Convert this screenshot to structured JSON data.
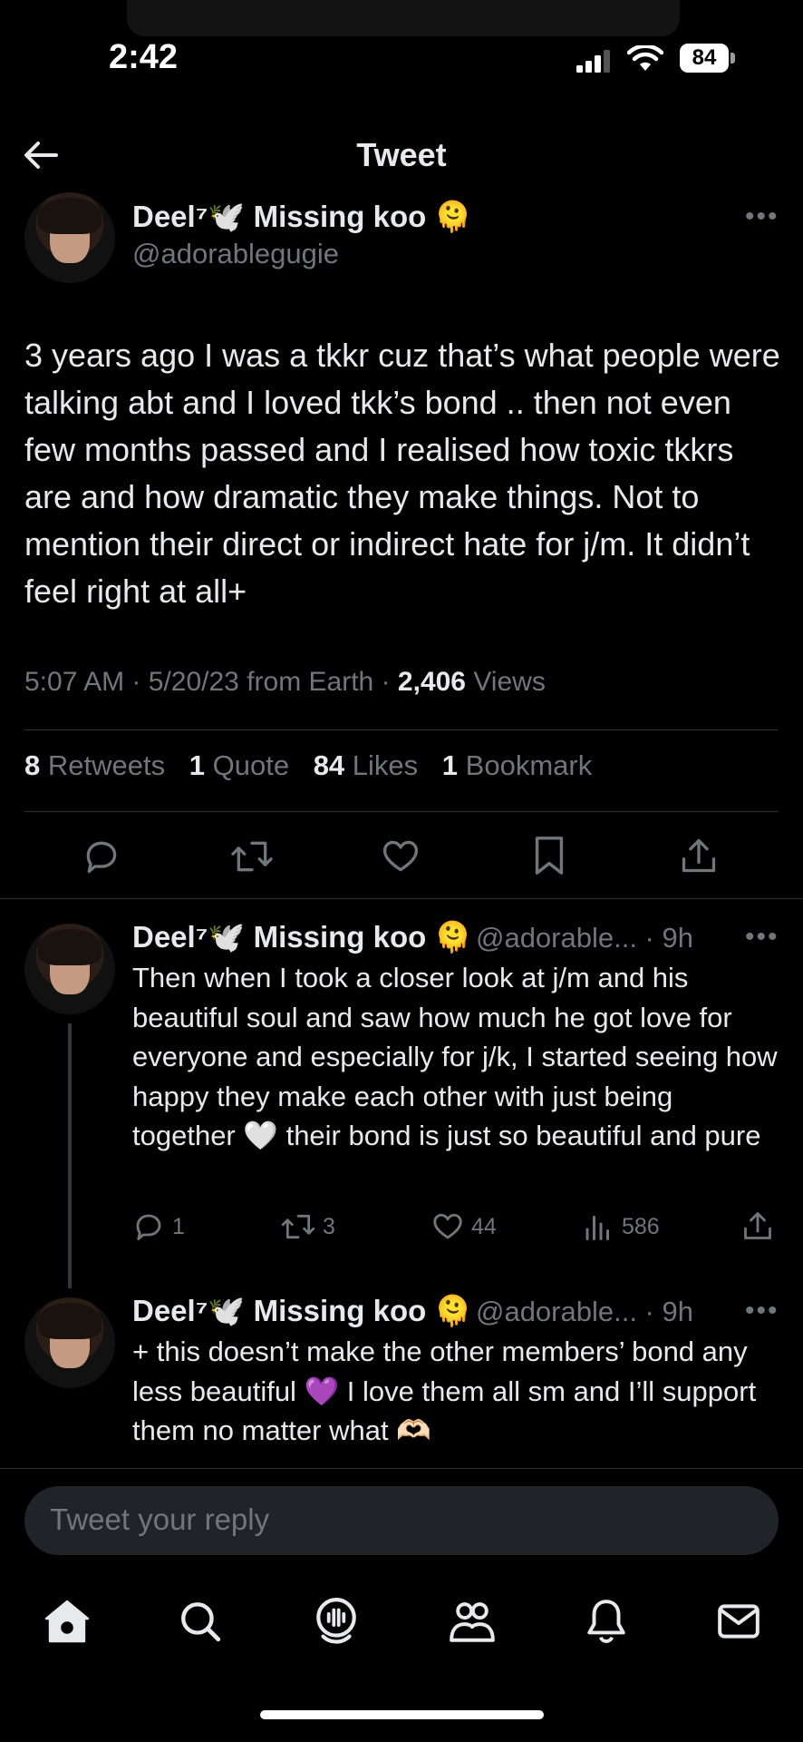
{
  "status_bar": {
    "time": "2:42",
    "battery": "84"
  },
  "header": {
    "title": "Tweet"
  },
  "tweet": {
    "author_name": "Deel⁷🕊️ Missing koo 🫠",
    "handle": "@adorablegugie",
    "text": "3 years ago I was a tkkr cuz that’s what people were talking abt and I loved tkk’s bond .. then not even few months passed and I realised how toxic tkkrs are and how dramatic they make things. Not to mention their direct or indirect hate for j/m. It didn’t feel right at all+",
    "time": "5:07 AM",
    "sep1": "·",
    "date": "5/20/23 from Earth",
    "sep2": "·",
    "views_count": "2,406",
    "views_label": "Views",
    "stats": {
      "retweets_count": "8",
      "retweets_label": "Retweets",
      "quotes_count": "1",
      "quotes_label": "Quote",
      "likes_count": "84",
      "likes_label": "Likes",
      "bookmarks_count": "1",
      "bookmarks_label": "Bookmark"
    }
  },
  "replies": [
    {
      "author_name": "Deel⁷🕊️ Missing koo 🫠",
      "handle_time": "@adorable... · 9h",
      "text": "Then when I took a closer look at j/m and his beautiful soul and saw how much he got love for everyone and especially for j/k, I started seeing how happy they make each other with just being together 🤍 their bond is just so beautiful and pure",
      "replies": "1",
      "retweets": "3",
      "likes": "44",
      "views": "586"
    },
    {
      "author_name": "Deel⁷🕊️ Missing koo 🫠",
      "handle_time": "@adorable... · 9h",
      "text": "+ this doesn’t make the other members’ bond any less beautiful 💜 I love them all sm and I’ll support them no matter what 🫶🏻"
    }
  ],
  "composer": {
    "placeholder": "Tweet your reply"
  },
  "icons": {
    "back": "arrow-left-icon",
    "more": "more-icon",
    "reply": "reply-icon",
    "retweet": "retweet-icon",
    "like": "heart-icon",
    "bookmark": "bookmark-icon",
    "share": "share-icon",
    "views": "views-icon",
    "home": "home-icon",
    "search": "search-icon",
    "spaces": "spaces-icon",
    "communities": "communities-icon",
    "notifications": "bell-icon",
    "messages": "mail-icon"
  },
  "colors": {
    "background": "#000000",
    "text": "#e7e9ea",
    "secondary": "#71767b",
    "divider": "#2f3336"
  }
}
